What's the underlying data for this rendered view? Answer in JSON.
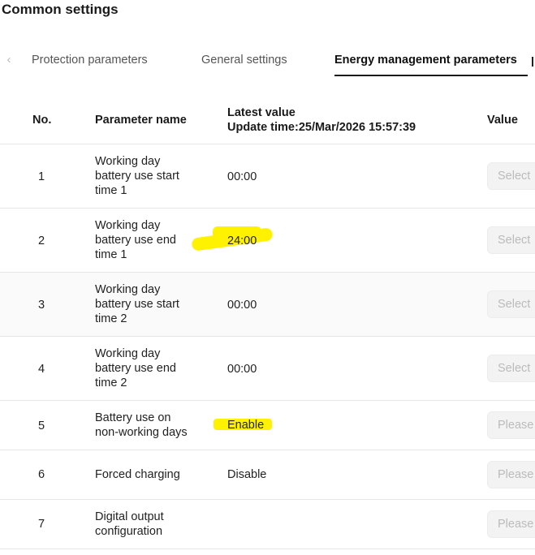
{
  "page_title": "Common settings",
  "tabs": {
    "prev_icon": "chevron-left-icon",
    "items": [
      {
        "label": "Protection parameters"
      },
      {
        "label": "General settings"
      },
      {
        "label": "Energy management parameters"
      }
    ]
  },
  "table": {
    "headers": {
      "no": "No.",
      "name": "Parameter name",
      "latest_line1": "Latest value",
      "latest_line2": "Update time:25/Mar/2026 15:57:39",
      "value": "Value"
    },
    "rows": [
      {
        "no": "1",
        "name_lines": [
          "Working day",
          "battery use start",
          "time 1"
        ],
        "latest": "00:00",
        "value_placeholder": "Select"
      },
      {
        "no": "2",
        "name_lines": [
          "Working day",
          "battery use end",
          "time 1"
        ],
        "latest": "24:00",
        "value_placeholder": "Select"
      },
      {
        "no": "3",
        "name_lines": [
          "Working day",
          "battery use start",
          "time 2"
        ],
        "latest": "00:00",
        "value_placeholder": "Select"
      },
      {
        "no": "4",
        "name_lines": [
          "Working day",
          "battery use end",
          "time 2"
        ],
        "latest": "00:00",
        "value_placeholder": "Select"
      },
      {
        "no": "5",
        "name_lines": [
          "Battery use on",
          "non-working days"
        ],
        "latest": "Enable",
        "value_placeholder": "Please"
      },
      {
        "no": "6",
        "name_lines": [
          "Forced charging"
        ],
        "latest": "Disable",
        "value_placeholder": "Please"
      },
      {
        "no": "7",
        "name_lines": [
          "Digital output",
          "configuration"
        ],
        "latest": "",
        "value_placeholder": "Please"
      }
    ]
  },
  "colors": {
    "highlight": "#fff200",
    "row_border": "#e6e6e6",
    "placeholder_text": "#bbbbbb"
  }
}
